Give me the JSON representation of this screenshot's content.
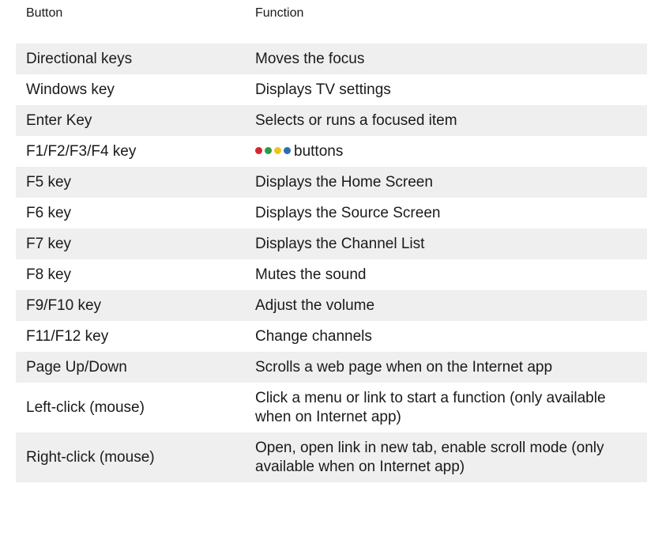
{
  "header": {
    "button": "Button",
    "function": "Function"
  },
  "rows": [
    {
      "button": "Directional keys",
      "function": "Moves the focus"
    },
    {
      "button": "Windows key",
      "function": "Displays TV settings"
    },
    {
      "button": "Enter Key",
      "function": "Selects or runs a focused item"
    },
    {
      "button": "F1/F2/F3/F4 key",
      "function": "buttons",
      "dots": [
        "#d7262e",
        "#2e9a45",
        "#f0c21c",
        "#2b6cb5"
      ]
    },
    {
      "button": "F5 key",
      "function": "Displays the Home Screen"
    },
    {
      "button": "F6 key",
      "function": "Displays the Source Screen"
    },
    {
      "button": "F7 key",
      "function": "Displays the Channel List"
    },
    {
      "button": "F8 key",
      "function": "Mutes the sound"
    },
    {
      "button": "F9/F10 key",
      "function": "Adjust the volume"
    },
    {
      "button": "F11/F12 key",
      "function": "Change channels"
    },
    {
      "button": "Page Up/Down",
      "function": "Scrolls a web page when on the Internet app"
    },
    {
      "button": "Left-click (mouse)",
      "function": "Click a menu or link to start a function (only available when on Internet app)"
    },
    {
      "button": "Right-click (mouse)",
      "function": "Open, open link in new tab, enable scroll mode (only available when on Internet app)"
    }
  ]
}
